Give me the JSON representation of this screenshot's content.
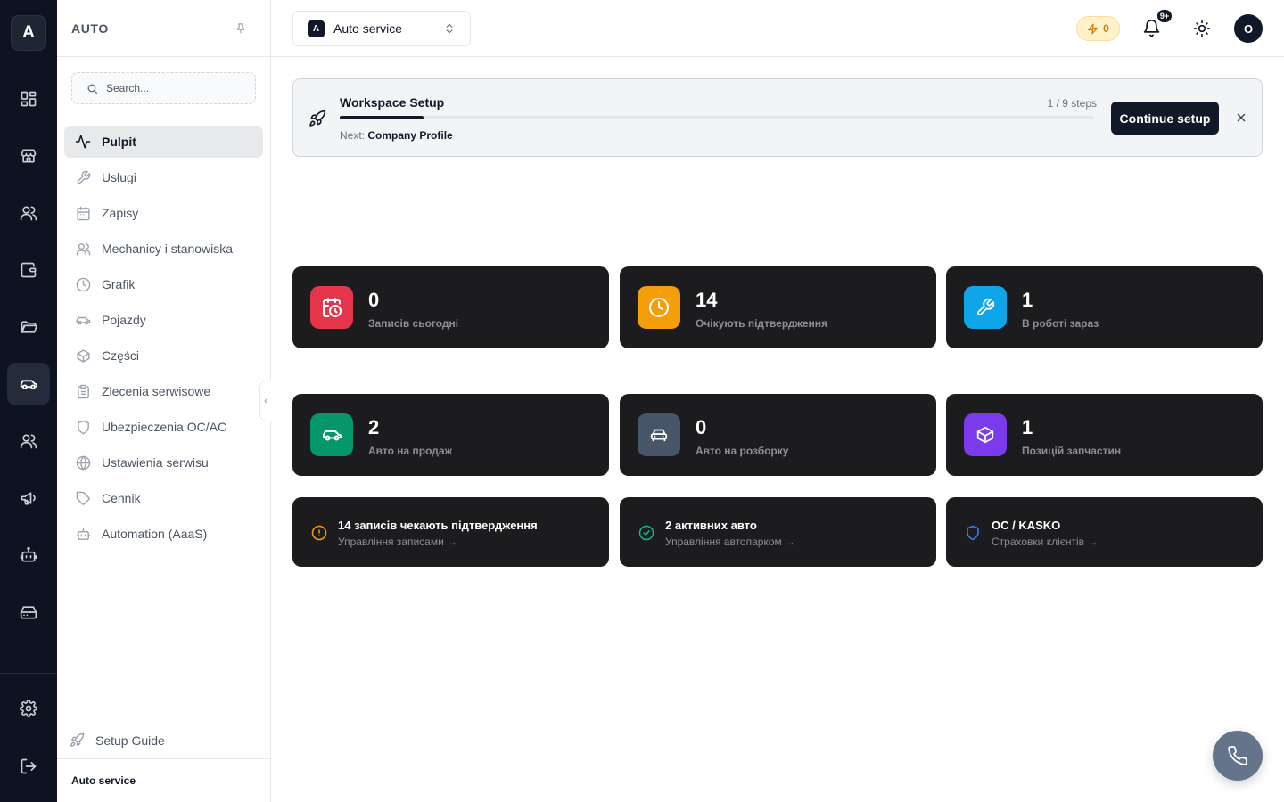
{
  "rail": {
    "logo_letter": "A",
    "items": [
      {
        "icon": "dashboard-icon"
      },
      {
        "icon": "store-icon"
      },
      {
        "icon": "users-icon"
      },
      {
        "icon": "wallet-icon"
      },
      {
        "icon": "folder-icon"
      },
      {
        "icon": "car-icon",
        "active": true
      },
      {
        "icon": "team-icon"
      },
      {
        "icon": "megaphone-icon"
      },
      {
        "icon": "robot-icon"
      },
      {
        "icon": "storage-icon"
      }
    ],
    "bottom": [
      {
        "icon": "settings-icon"
      },
      {
        "icon": "logout-icon"
      }
    ]
  },
  "sidebar": {
    "brand": "AUTO",
    "search_placeholder": "Search...",
    "items": [
      {
        "label": "Pulpit",
        "icon": "activity-icon",
        "active": true
      },
      {
        "label": "Usługi",
        "icon": "wrench-icon"
      },
      {
        "label": "Zapisy",
        "icon": "calendar-icon"
      },
      {
        "label": "Mechanicy i stanowiska",
        "icon": "users-icon"
      },
      {
        "label": "Grafik",
        "icon": "clock-icon"
      },
      {
        "label": "Pojazdy",
        "icon": "car-icon"
      },
      {
        "label": "Części",
        "icon": "box-icon"
      },
      {
        "label": "Zlecenia serwisowe",
        "icon": "clipboard-icon"
      },
      {
        "label": "Ubezpieczenia OC/AC",
        "icon": "shield-icon"
      },
      {
        "label": "Ustawienia serwisu",
        "icon": "globe-icon"
      },
      {
        "label": "Cennik",
        "icon": "tag-icon"
      },
      {
        "label": "Automation (AaaS)",
        "icon": "bot-icon"
      }
    ],
    "setup_guide": "Setup Guide",
    "footer": "Auto service"
  },
  "topbar": {
    "workspace_badge": "A",
    "workspace_name": "Auto service",
    "credits": "0",
    "notifications_badge": "9+",
    "avatar": "O"
  },
  "banner": {
    "title": "Workspace Setup",
    "steps": "1 / 9 steps",
    "progress": 0.111,
    "next_label": "Next:",
    "next_value": "Company Profile",
    "button": "Continue setup"
  },
  "stats": [
    {
      "value": "0",
      "label": "Записів сьогодні",
      "color": "#e5354a",
      "icon": "calendar-clock-icon"
    },
    {
      "value": "14",
      "label": "Очікують підтвердження",
      "color": "#f59e0b",
      "icon": "clock-icon"
    },
    {
      "value": "1",
      "label": "В роботі зараз",
      "color": "#0ea5e9",
      "icon": "wrench-icon"
    },
    {
      "value": "2",
      "label": "Авто на продаж",
      "color": "#059669",
      "icon": "car-icon"
    },
    {
      "value": "0",
      "label": "Авто на розборку",
      "color": "#475569",
      "icon": "car-front-icon"
    },
    {
      "value": "1",
      "label": "Позицій запчастин",
      "color": "#7c3aed",
      "icon": "package-icon"
    }
  ],
  "links": [
    {
      "title": "14 записів чекають підтвердження",
      "sub": "Управління записами →",
      "color": "#f59e0b",
      "icon": "alert-circle-icon"
    },
    {
      "title": "2 активних авто",
      "sub": "Управління автопарком →",
      "color": "#10b981",
      "icon": "check-circle-icon"
    },
    {
      "title": "OC / KASKO",
      "sub": "Страховки клієнтів →",
      "color": "#3b82f6",
      "icon": "shield-icon"
    }
  ]
}
